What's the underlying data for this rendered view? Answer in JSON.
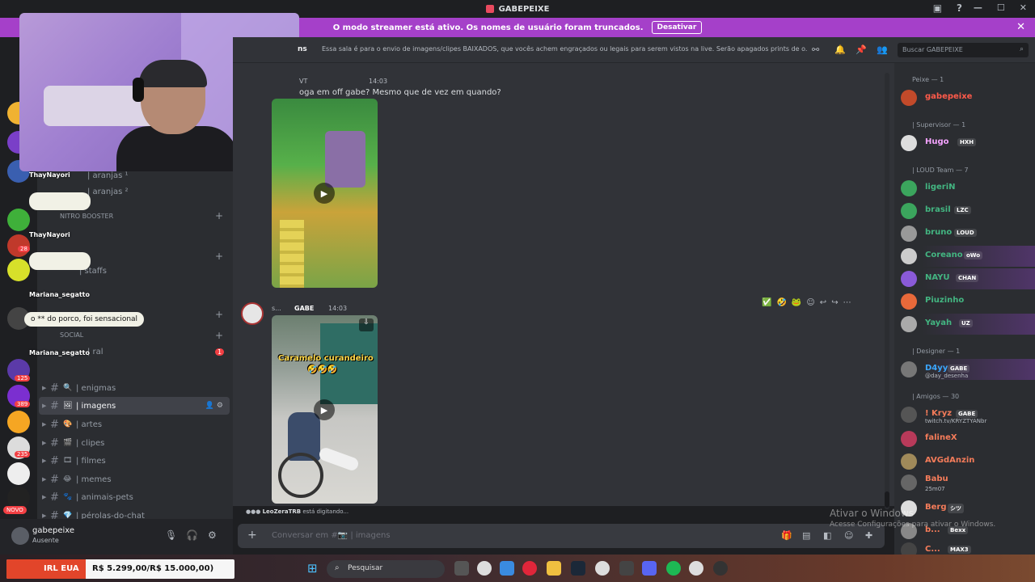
{
  "window": {
    "title": "GABEPEIXE"
  },
  "banner": {
    "text": "O modo streamer está ativo. Os nomes de usuário foram truncados.",
    "button": "Desativar"
  },
  "header": {
    "channel_title": "ns",
    "topic": "Essa sala é para o envio de imagens/clipes BAIXADOS, que vocês achem engraçados ou legais para serem vistos na live. Serão apagados prints de o...",
    "search_placeholder": "Buscar GABEPEIXE"
  },
  "sidebar": {
    "categories": [
      "NITRO BOOSTER",
      "SOCIAL"
    ],
    "partial_channels": [
      "| aranjas ¹",
      "| aranjas ²",
      "| staffs",
      "| ral"
    ],
    "channels": [
      {
        "emoji": "🔍",
        "name": "| enigmas"
      },
      {
        "emoji": "🖼",
        "name": "| imagens"
      },
      {
        "emoji": "🎨",
        "name": "| artes"
      },
      {
        "emoji": "🎬",
        "name": "| clipes"
      },
      {
        "emoji": "🎞",
        "name": "| filmes"
      },
      {
        "emoji": "😂",
        "name": "| memes"
      },
      {
        "emoji": "🐾",
        "name": "| animais-pets"
      },
      {
        "emoji": "💎",
        "name": "| pérolas-do-chat"
      }
    ],
    "unread_badge": "1"
  },
  "user": {
    "name": "gabepeixe",
    "status": "Ausente"
  },
  "rail_badges": [
    "28",
    "125",
    "389",
    "235"
  ],
  "rail_new": "NOVO",
  "overlay_chat": [
    {
      "name": "ThayNayori",
      "text": ""
    },
    {
      "name": "ThayNayori",
      "text": ""
    },
    {
      "name": "Mariana_segatto",
      "text": "o ** do porco, foi sensacional"
    },
    {
      "name": "Mariana_segatto",
      "text": ""
    }
  ],
  "messages": [
    {
      "author": "VT",
      "time": "14:03",
      "text": "oga em off gabe? Mesmo que de vez em quando?"
    },
    {
      "author": "s...",
      "tag": "GABE",
      "time": "14:03",
      "video_caption": "Caramelo curandeiro",
      "video_caption_emoji": "🤣🤣🤣"
    }
  ],
  "typing": {
    "user": "LeoZeraTRB",
    "text": "está digitando..."
  },
  "composer": {
    "placeholder": "Conversar em #📷 | imagens"
  },
  "members": {
    "roles": [
      {
        "name": "Peixe — 1"
      },
      {
        "name": "| Supervisor — 1"
      },
      {
        "name": "| LOUD Team — 7"
      },
      {
        "name": "| Designer — 1"
      },
      {
        "name": "| Amigos — 30"
      }
    ],
    "list": [
      {
        "name": "gabepeixe",
        "color": "#ff5a4a",
        "tag": ""
      },
      {
        "name": "Hugo",
        "color": "#f5a3ff",
        "tag": "HXH"
      },
      {
        "name": "ligeriN",
        "color": "#43b581",
        "tag": ""
      },
      {
        "name": "brasil",
        "color": "#43b581",
        "tag": "LZC"
      },
      {
        "name": "bruno",
        "color": "#43b581",
        "tag": "LOUD"
      },
      {
        "name": "Coreano",
        "color": "#43b581",
        "tag": "oWo"
      },
      {
        "name": "NAYU",
        "color": "#43b581",
        "tag": "CHAN"
      },
      {
        "name": "Piuzinho",
        "color": "#43b581",
        "tag": ""
      },
      {
        "name": "Yayah",
        "color": "#43b581",
        "tag": "UZ"
      },
      {
        "name": "D4yy",
        "color": "#3ba7ff",
        "tag": "GABE",
        "sub": "@day_desenha"
      },
      {
        "name": "! Kryz",
        "color": "#f57c5a",
        "tag": "GABE",
        "sub": "twitch.tv/KRYZTYANbr"
      },
      {
        "name": "falineX",
        "color": "#f57c5a",
        "tag": ""
      },
      {
        "name": "AVGdAnzin",
        "color": "#f57c5a",
        "tag": ""
      },
      {
        "name": "Babu",
        "color": "#f57c5a",
        "tag": "",
        "sub": "25m07"
      },
      {
        "name": "Berg",
        "color": "#f57c5a",
        "tag": "シツ"
      },
      {
        "name": "b...",
        "color": "#f57c5a",
        "tag": "Bexx"
      },
      {
        "name": "C...",
        "color": "#f57c5a",
        "tag": "MAX3"
      }
    ]
  },
  "windows_watermark": {
    "line1": "Ativar o Windows",
    "line2": "Acesse Configurações para ativar o Windows."
  },
  "irl_overlay": {
    "label": "IRL EUA",
    "value": "R$ 5.299,00/R$ 15.000,00)"
  },
  "taskbar": {
    "search_placeholder": "Pesquisar"
  }
}
